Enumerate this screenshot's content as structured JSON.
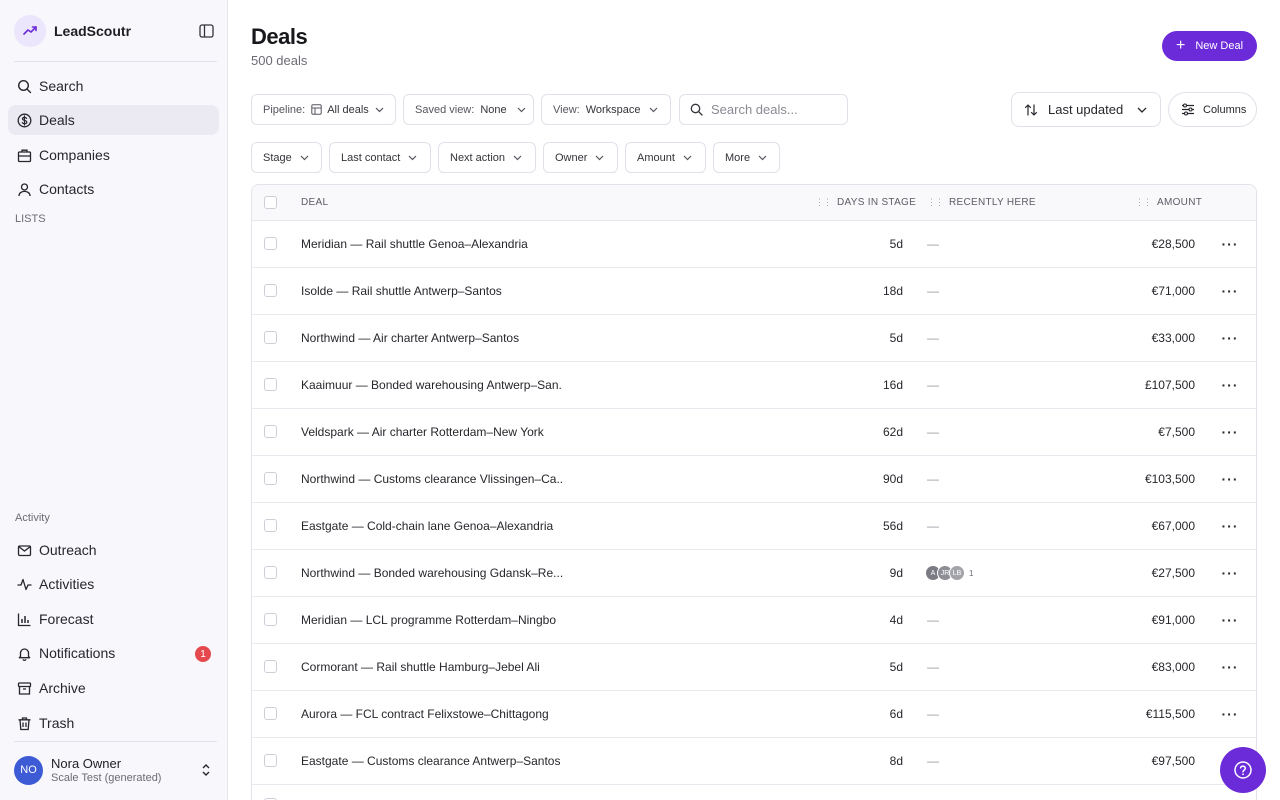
{
  "app": {
    "name": "LeadScoutr"
  },
  "sidebar": {
    "nav": [
      {
        "label": "Search",
        "icon": "search-icon"
      },
      {
        "label": "Deals",
        "icon": "dollar-icon",
        "active": true
      },
      {
        "label": "Companies",
        "icon": "building-icon"
      },
      {
        "label": "Contacts",
        "icon": "user-icon"
      }
    ],
    "lists_heading": "LISTS",
    "activity_heading": "Activity",
    "activity": [
      {
        "label": "Outreach",
        "icon": "mail-icon"
      },
      {
        "label": "Activities",
        "icon": "activity-icon"
      },
      {
        "label": "Forecast",
        "icon": "bar-chart-icon"
      },
      {
        "label": "Notifications",
        "icon": "bell-icon",
        "badge": "1"
      },
      {
        "label": "Archive",
        "icon": "archive-icon"
      },
      {
        "label": "Trash",
        "icon": "trash-icon"
      }
    ],
    "user": {
      "initials": "NO",
      "name": "Nora Owner",
      "org": "Scale Test (generated)"
    }
  },
  "header": {
    "title": "Deals",
    "subtitle": "500 deals",
    "new_button": "New Deal"
  },
  "toolbar": {
    "pipeline_label": "Pipeline:",
    "pipeline_value": "All deals",
    "saved_view_label": "Saved view:",
    "saved_view_value": "None",
    "view_label": "View:",
    "view_value": "Workspace",
    "search_placeholder": "Search deals...",
    "sort_label": "Last updated",
    "columns_label": "Columns"
  },
  "filters": [
    "Stage",
    "Last contact",
    "Next action",
    "Owner",
    "Amount",
    "More"
  ],
  "table": {
    "columns": {
      "deal": "DEAL",
      "days": "DAYS IN STAGE",
      "recent": "RECENTLY HERE",
      "amount": "AMOUNT"
    },
    "rows": [
      {
        "deal": "Meridian — Rail shuttle Genoa–Alexandria",
        "days": "5d",
        "recent": "—",
        "amount": "€28,500"
      },
      {
        "deal": "Isolde — Rail shuttle Antwerp–Santos",
        "days": "18d",
        "recent": "—",
        "amount": "€71,000"
      },
      {
        "deal": "Northwind — Air charter Antwerp–Santos",
        "days": "5d",
        "recent": "—",
        "amount": "€33,000"
      },
      {
        "deal": "Kaaimuur — Bonded warehousing Antwerp–San...",
        "days": "16d",
        "recent": "—",
        "amount": "£107,500"
      },
      {
        "deal": "Veldspark — Air charter Rotterdam–New York",
        "days": "62d",
        "recent": "—",
        "amount": "€7,500"
      },
      {
        "deal": "Northwind — Customs clearance Vlissingen–Ca...",
        "days": "90d",
        "recent": "—",
        "amount": "€103,500"
      },
      {
        "deal": "Eastgate — Cold-chain lane Genoa–Alexandria",
        "days": "56d",
        "recent": "—",
        "amount": "€67,000"
      },
      {
        "deal": "Northwind — Bonded warehousing Gdansk–Re...",
        "days": "9d",
        "recent_avatars": [
          "A",
          "JR",
          "LB"
        ],
        "recent_more": "1",
        "amount": "€27,500"
      },
      {
        "deal": "Meridian — LCL programme Rotterdam–Ningbo",
        "days": "4d",
        "recent": "—",
        "amount": "€91,000"
      },
      {
        "deal": "Cormorant — Rail shuttle Hamburg–Jebel Ali",
        "days": "5d",
        "recent": "—",
        "amount": "€83,000"
      },
      {
        "deal": "Aurora — FCL contract Felixstowe–Chittagong",
        "days": "6d",
        "recent": "—",
        "amount": "€115,500"
      },
      {
        "deal": "Eastgate — Customs clearance Antwerp–Santos",
        "days": "8d",
        "recent": "—",
        "amount": "€97,500"
      }
    ]
  },
  "colors": {
    "accent": "#6c2bd9",
    "sidebar_bg": "#f8f7fb",
    "badge": "#e5484d",
    "avatar": "#3d5bd4"
  }
}
